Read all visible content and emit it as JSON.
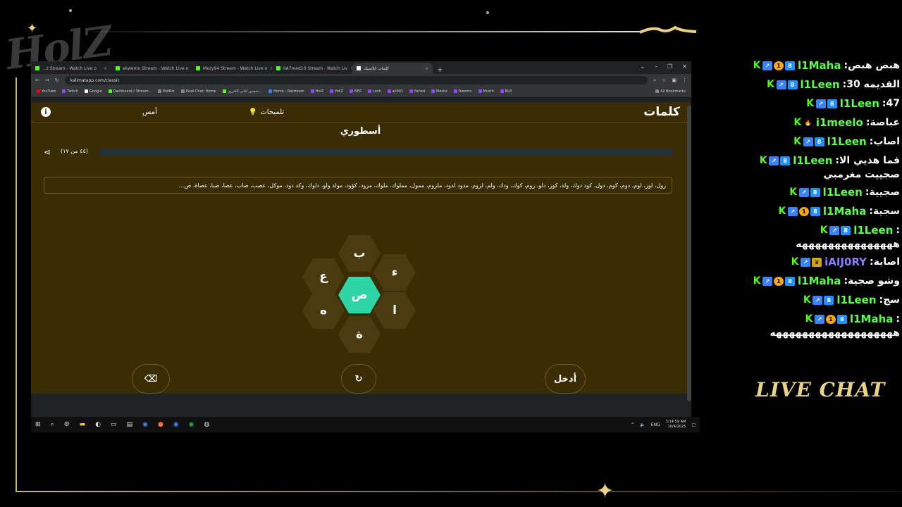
{
  "overlay": {
    "logo": "HolZ",
    "live_chat_label": "LIVE CHAT"
  },
  "browser": {
    "tabs": [
      {
        "label": "...z Stream - Watch Live o",
        "active": false
      },
      {
        "label": "xkwemn Stream - Watch Live o",
        "active": false
      },
      {
        "label": "Mezy94 Stream - Watch Live o",
        "active": false
      },
      {
        "label": "IIA7med10 Stream - Watch Liv",
        "active": false
      },
      {
        "label": "كلمات كلاسيك",
        "active": true
      }
    ],
    "url": "kalimatapp.com/classic",
    "bookmarks": [
      "YouTube",
      "Twitch",
      "Google",
      "Dashboard / Stream...",
      "BotRix",
      "Pixel Chat: Home",
      "تحسين اغاني الكترون...",
      "Home - Restream",
      "HolZ",
      "HolZ",
      "NFR",
      "Lozh",
      "ak901",
      "Fahed",
      "Meshz",
      "Rwemn",
      "Musth",
      "BL8"
    ],
    "all_bookmarks": "All Bookmarks"
  },
  "app": {
    "brand": "كلمات",
    "hints_label": "تلميحات",
    "yesterday_label": "أمس",
    "rank": "أسطوري",
    "score": "(٤٤ من ١٧)",
    "progress_fraction": 0.0,
    "found_words": "زول، لوز، لوم، دوم، كوم، دول، كود دوك، ولد، كوز، دلو، زوم، كوك، ودك، ولم، لزوم، مدود لدود، ملزوم، ممول، مملوك، ملوك، مزود، كؤود، مولد ولو، دلوك، وكد دود، موكل، عصب، صاب، عصا، صبا، عصاة، ص...",
    "letters": {
      "center": "ص",
      "top": "ب",
      "top_right": "ء",
      "bottom_right": "ا",
      "bottom": "ة",
      "bottom_left": "ه",
      "top_left": "ع"
    },
    "enter_label": "أدخل"
  },
  "taskbar": {
    "lang": "ENG",
    "time": "3:14:59 AM",
    "date": "10/4/2025"
  },
  "chat": [
    {
      "user": "l1Maha",
      "text": "هبص هبص",
      "badges": [
        "k",
        "arrow",
        "one",
        "g"
      ],
      "color": "green"
    },
    {
      "user": "l1Leen",
      "text": "القديمه 30",
      "badges": [
        "k",
        "arrow",
        "g"
      ],
      "color": "green"
    },
    {
      "user": "l1Leen",
      "text": "47",
      "badges": [
        "k",
        "arrow",
        "g"
      ],
      "color": "green"
    },
    {
      "user": "i1meelo",
      "text": "عباصة",
      "badges": [
        "k",
        "fire"
      ],
      "color": "green"
    },
    {
      "user": "l1Leen",
      "text": "اصاب",
      "badges": [
        "k",
        "arrow",
        "g"
      ],
      "color": "green"
    },
    {
      "user": "l1Leen",
      "text": "فما هذيي الا",
      "continuation": "صجييت مغرمبي",
      "badges": [
        "k",
        "arrow",
        "g"
      ],
      "color": "green"
    },
    {
      "user": "l1Leen",
      "text": "صجيية",
      "badges": [
        "k",
        "arrow",
        "g"
      ],
      "color": "green"
    },
    {
      "user": "l1Maha",
      "text": "سجية",
      "badges": [
        "k",
        "arrow",
        "one",
        "g"
      ],
      "color": "green"
    },
    {
      "user": "l1Leen",
      "text": "",
      "continuation": "هههههههههههههههه",
      "badges": [
        "k",
        "arrow",
        "g"
      ],
      "color": "green"
    },
    {
      "user": "iAIJ0RY",
      "text": "اصابة",
      "badges": [
        "k",
        "arrow",
        "crown"
      ],
      "color": "purple"
    },
    {
      "user": "l1Maha",
      "text": "وشو صجية",
      "badges": [
        "k",
        "arrow",
        "one",
        "g"
      ],
      "color": "green"
    },
    {
      "user": "l1Leen",
      "text": "سج",
      "badges": [
        "k",
        "arrow",
        "g"
      ],
      "color": "green"
    },
    {
      "user": "l1Maha",
      "text": "",
      "continuation": "هههههههههههههههههههه",
      "badges": [
        "k",
        "arrow",
        "one",
        "g"
      ],
      "color": "green"
    }
  ]
}
